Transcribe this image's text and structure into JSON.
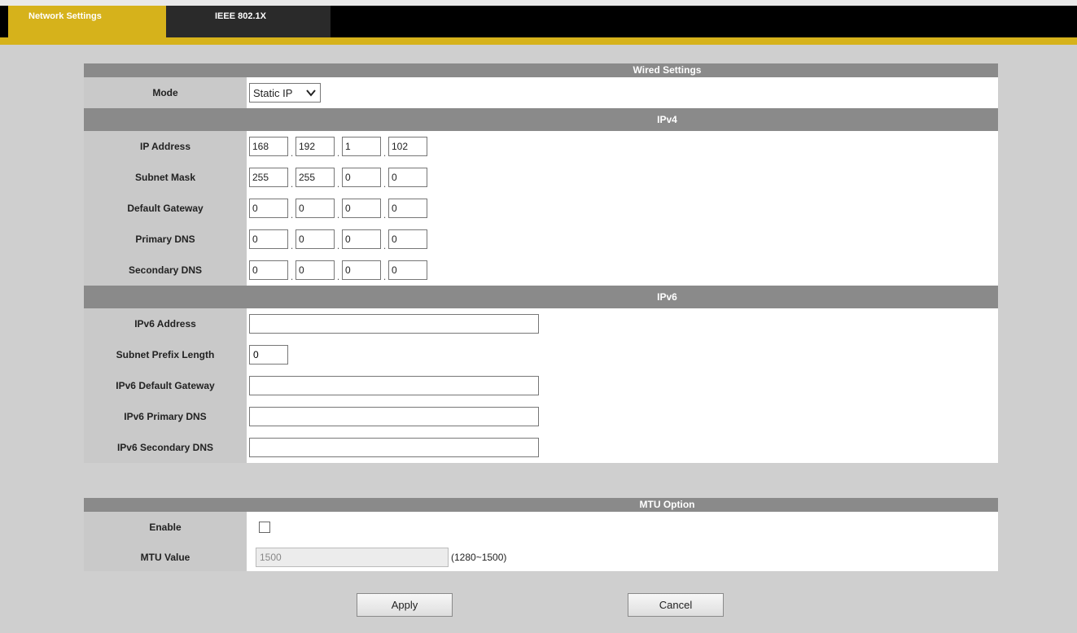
{
  "tabs": [
    {
      "label": "Network Settings",
      "active": true
    },
    {
      "label": "IEEE 802.1X",
      "active": false
    }
  ],
  "wired": {
    "header": "Wired Settings",
    "mode_label": "Mode",
    "mode_value": "Static IP"
  },
  "ipv4": {
    "header": "IPv4",
    "rows": [
      {
        "label": "IP Address",
        "octets": [
          "168",
          "192",
          "1",
          "102"
        ]
      },
      {
        "label": "Subnet Mask",
        "octets": [
          "255",
          "255",
          "0",
          "0"
        ]
      },
      {
        "label": "Default Gateway",
        "octets": [
          "0",
          "0",
          "0",
          "0"
        ]
      },
      {
        "label": "Primary DNS",
        "octets": [
          "0",
          "0",
          "0",
          "0"
        ]
      },
      {
        "label": "Secondary DNS",
        "octets": [
          "0",
          "0",
          "0",
          "0"
        ]
      }
    ]
  },
  "ipv6": {
    "header": "IPv6",
    "address_label": "IPv6 Address",
    "address_value": "",
    "prefix_label": "Subnet Prefix Length",
    "prefix_value": "0",
    "gateway_label": "IPv6 Default Gateway",
    "gateway_value": "",
    "primary_dns_label": "IPv6 Primary DNS",
    "primary_dns_value": "",
    "secondary_dns_label": "IPv6 Secondary DNS",
    "secondary_dns_value": ""
  },
  "mtu": {
    "header": "MTU Option",
    "enable_label": "Enable",
    "enabled": false,
    "value_label": "MTU Value",
    "value": "1500",
    "range_hint": "(1280~1500)"
  },
  "buttons": {
    "apply": "Apply",
    "cancel": "Cancel"
  },
  "colors": {
    "accent": "#d6b21b",
    "header_bar": "#8a8a8a",
    "label_bg": "#c9c9c9",
    "page_bg": "#cfcfcf"
  }
}
